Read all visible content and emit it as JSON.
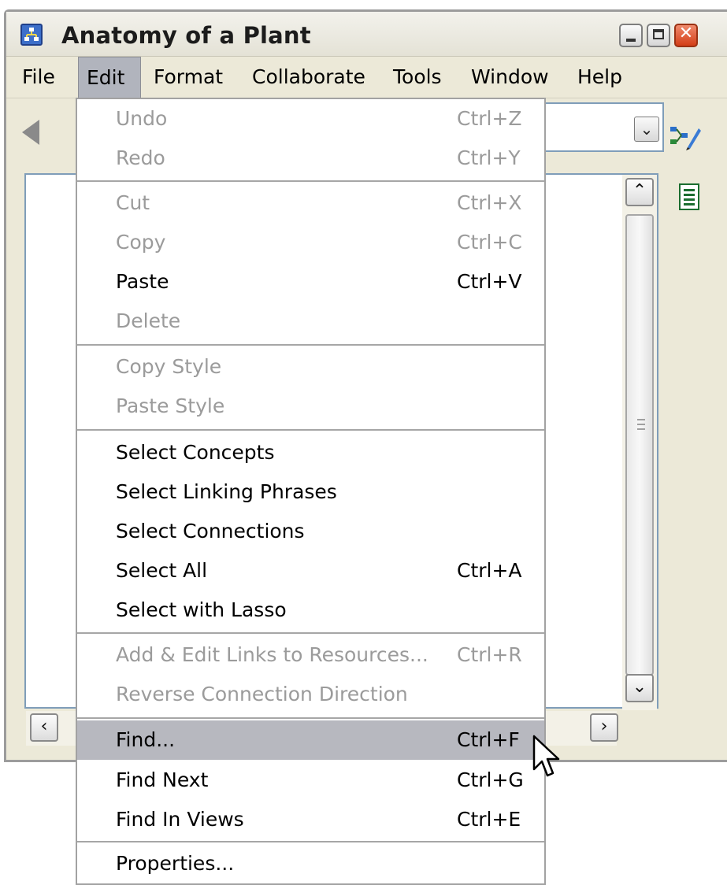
{
  "window": {
    "title": "Anatomy of a Plant",
    "app_icon": "concept-map-icon",
    "controls": [
      "minimize-icon",
      "maximize-icon",
      "close-icon"
    ]
  },
  "menubar": {
    "items": [
      {
        "label": "File"
      },
      {
        "label": "Edit",
        "active": true
      },
      {
        "label": "Format"
      },
      {
        "label": "Collaborate"
      },
      {
        "label": "Tools"
      },
      {
        "label": "Window"
      },
      {
        "label": "Help"
      }
    ]
  },
  "edit_menu": {
    "items": [
      {
        "label": "Undo",
        "shortcut": "Ctrl+Z",
        "enabled": false
      },
      {
        "label": "Redo",
        "shortcut": "Ctrl+Y",
        "enabled": false
      },
      {
        "label": "Cut",
        "shortcut": "Ctrl+X",
        "enabled": false
      },
      {
        "label": "Copy",
        "shortcut": "Ctrl+C",
        "enabled": false
      },
      {
        "label": "Paste",
        "shortcut": "Ctrl+V",
        "enabled": true
      },
      {
        "label": "Delete",
        "shortcut": "",
        "enabled": false
      },
      {
        "label": "Copy Style",
        "shortcut": "",
        "enabled": false
      },
      {
        "label": "Paste Style",
        "shortcut": "",
        "enabled": false
      },
      {
        "label": "Select Concepts",
        "shortcut": "",
        "enabled": true
      },
      {
        "label": "Select Linking Phrases",
        "shortcut": "",
        "enabled": true
      },
      {
        "label": "Select Connections",
        "shortcut": "",
        "enabled": true
      },
      {
        "label": "Select All",
        "shortcut": "Ctrl+A",
        "enabled": true
      },
      {
        "label": "Select with Lasso",
        "shortcut": "",
        "enabled": true
      },
      {
        "label": "Add & Edit Links to Resources...",
        "shortcut": "Ctrl+R",
        "enabled": false
      },
      {
        "label": "Reverse Connection Direction",
        "shortcut": "",
        "enabled": false
      },
      {
        "label": "Find...",
        "shortcut": "Ctrl+F",
        "enabled": true,
        "highlighted": true
      },
      {
        "label": "Find Next",
        "shortcut": "Ctrl+G",
        "enabled": true
      },
      {
        "label": "Find In Views",
        "shortcut": "Ctrl+E",
        "enabled": true
      },
      {
        "label": "Properties...",
        "shortcut": "",
        "enabled": true
      }
    ]
  },
  "toolbar": {
    "back_icon": "back-arrow-icon",
    "combo_value": "",
    "tool_icon": "concept-tool-icon",
    "side_icon": "document-icon"
  },
  "colors": {
    "highlight": "#b7b8bf",
    "disabled_text": "#9b9b9b",
    "chrome": "#ece9d8"
  }
}
